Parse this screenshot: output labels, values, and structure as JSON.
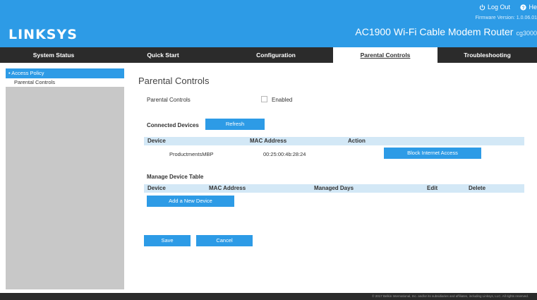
{
  "header": {
    "logo": "LINKSYS",
    "logout_label": "Log Out",
    "help_label": "He",
    "firmware": "Firmware Version: 1.0.06.01",
    "model": "AC1900 Wi-Fi Cable Modem Router",
    "model_suffix": "cg3000"
  },
  "nav": {
    "tabs": [
      {
        "label": "System Status",
        "active": false
      },
      {
        "label": "Quick Start",
        "active": false
      },
      {
        "label": "Configuration",
        "active": false
      },
      {
        "label": "Parental Controls",
        "active": true
      },
      {
        "label": "Troubleshooting",
        "active": false
      }
    ]
  },
  "sidebar": {
    "items": [
      {
        "label": "• Access Policy",
        "active": true
      },
      {
        "label": "Parental Controls",
        "active": false
      }
    ]
  },
  "main": {
    "title": "Parental Controls",
    "parental_controls_label": "Parental Controls",
    "enabled_label": "Enabled",
    "enabled_checked": false,
    "connected": {
      "title": "Connected Devices",
      "refresh_label": "Refresh",
      "headers": [
        "Device",
        "MAC Address",
        "Action"
      ],
      "rows": [
        {
          "device": "ProductmentsMBP",
          "mac": "00:25:00:4b:28:24",
          "action_label": "Block Internet Access"
        }
      ]
    },
    "manage": {
      "title": "Manage Device Table",
      "headers": [
        "Device",
        "MAC Address",
        "Managed Days",
        "Edit",
        "Delete"
      ],
      "add_label": "Add a New Device"
    },
    "save_label": "Save",
    "cancel_label": "Cancel"
  },
  "footer": {
    "text": "© 2017 Belkin International, Inc. and/or its subsidiaries and affiliates, including Linksys, LLC. All rights reserved."
  },
  "colors": {
    "brand_blue": "#2d9be6",
    "nav_dark": "#2b2b2b",
    "table_header": "#d3e8f6",
    "sidebar_gray": "#c8c8c8"
  }
}
